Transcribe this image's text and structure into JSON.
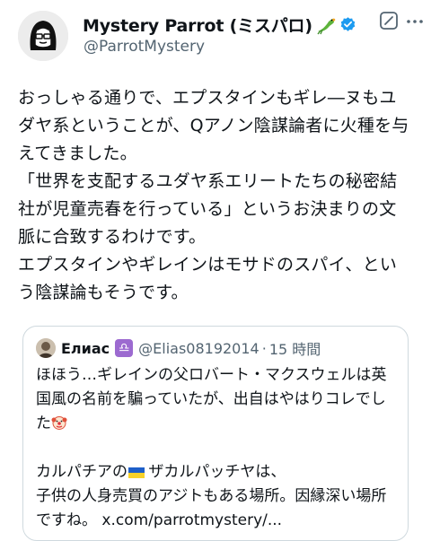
{
  "author": {
    "display_name": "Mystery Parrot (ミスパロ)",
    "handle": "@ParrotMystery",
    "verified": true,
    "avatar_icon": "woman-with-glasses-avatar"
  },
  "tweet": {
    "lines": [
      "おっしゃる通りで、エプスタインもギレ―ヌもユダヤ系ということが、Qアノン陰謀論者に火種を与えてきました。",
      "「世界を支配するユダヤ系エリートたちの秘密結社が児童売春を行っている」というお決まりの文脈に合致するわけです。",
      "エプスタインやギレインはモサドのスパイ、という陰謀論もそうです。"
    ]
  },
  "quote": {
    "display_name": "Елиас",
    "zodiac_badge": "♎",
    "handle": "@Elias08192014",
    "separator": "·",
    "time": "15 時間",
    "line1": "ほほう…ギレインの父ロバート・マクスウェルは英国風の名前を騙っていたが、出自はやはりコレでした",
    "line2_prefix": "カルパチアの",
    "line2_suffix": "ザカルパッチヤは、",
    "line3": "子供の人身売買のアジトもある場所。因縁深い場所ですね。 x.com/parrotmystery/..."
  },
  "colors": {
    "text": "#0f1419",
    "secondary": "#536471",
    "verified": "#1d9bf0",
    "border": "#cfd9de"
  }
}
